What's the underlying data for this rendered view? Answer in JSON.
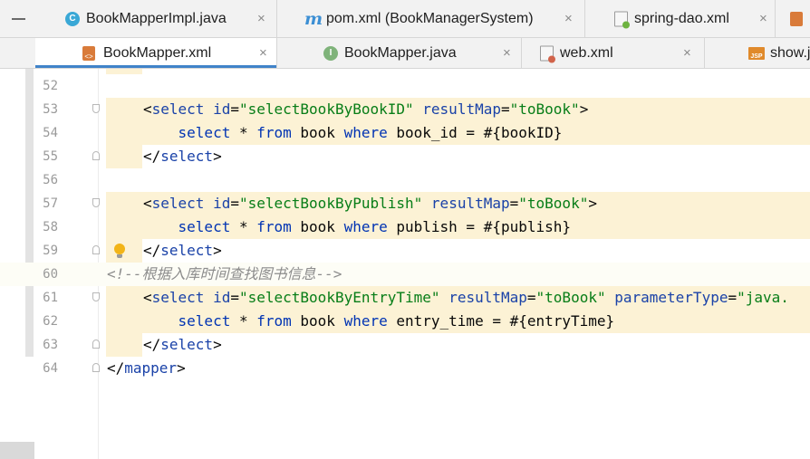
{
  "tabs_row1": [
    {
      "label": "BookMapperImpl.java",
      "icon": "class-icon",
      "close": "×"
    },
    {
      "label": "pom.xml (BookManagerSystem)",
      "icon": "maven-icon",
      "close": "×"
    },
    {
      "label": "spring-dao.xml",
      "icon": "spring-xml-icon",
      "close": "×"
    }
  ],
  "tabs_row2": [
    {
      "label": "BookMapper.xml",
      "icon": "mybatis-xml-icon",
      "close": "×",
      "active": true
    },
    {
      "label": "BookMapper.java",
      "icon": "interface-icon",
      "close": "×"
    },
    {
      "label": "web.xml",
      "icon": "web-xml-icon",
      "close": "×"
    },
    {
      "label": "show.j",
      "icon": "jsp-icon"
    }
  ],
  "icon_glyphs": {
    "class": "C",
    "interface": "I",
    "maven": "m",
    "xml": "<>",
    "jsp": "JSP"
  },
  "editor": {
    "lines": [
      {
        "num": "52",
        "parts": []
      },
      {
        "num": "53",
        "parts": [
          [
            "tag",
            "<"
          ],
          [
            "tname",
            "select"
          ],
          [
            "sp",
            " "
          ],
          [
            "attr",
            "id"
          ],
          [
            "tag",
            "="
          ],
          [
            "aval",
            "\"selectBookByBookID\""
          ],
          [
            "sp",
            " "
          ],
          [
            "attr",
            "resultMap"
          ],
          [
            "tag",
            "="
          ],
          [
            "aval",
            "\"toBook\""
          ],
          [
            "tag",
            ">"
          ]
        ]
      },
      {
        "num": "54",
        "parts": [
          [
            "sp",
            "    "
          ],
          [
            "kw",
            "select"
          ],
          [
            "sp",
            " * "
          ],
          [
            "kw",
            "from"
          ],
          [
            "sp",
            " book "
          ],
          [
            "kw",
            "where"
          ],
          [
            "sp",
            " book_id = #{bookID}"
          ]
        ]
      },
      {
        "num": "55",
        "parts": [
          [
            "tag",
            "</"
          ],
          [
            "tname",
            "select"
          ],
          [
            "tag",
            ">"
          ]
        ]
      },
      {
        "num": "56",
        "parts": []
      },
      {
        "num": "57",
        "parts": [
          [
            "tag",
            "<"
          ],
          [
            "tname",
            "select"
          ],
          [
            "sp",
            " "
          ],
          [
            "attr",
            "id"
          ],
          [
            "tag",
            "="
          ],
          [
            "aval",
            "\"selectBookByPublish\""
          ],
          [
            "sp",
            " "
          ],
          [
            "attr",
            "resultMap"
          ],
          [
            "tag",
            "="
          ],
          [
            "aval",
            "\"toBook\""
          ],
          [
            "tag",
            ">"
          ]
        ]
      },
      {
        "num": "58",
        "parts": [
          [
            "sp",
            "    "
          ],
          [
            "kw",
            "select"
          ],
          [
            "sp",
            " * "
          ],
          [
            "kw",
            "from"
          ],
          [
            "sp",
            " book "
          ],
          [
            "kw",
            "where"
          ],
          [
            "sp",
            " publish = #{publish}"
          ]
        ]
      },
      {
        "num": "59",
        "parts": [
          [
            "tag",
            "</"
          ],
          [
            "tname",
            "select"
          ],
          [
            "tag",
            ">"
          ]
        ]
      },
      {
        "num": "60",
        "parts": [
          [
            "comment",
            "<!--根据入库时间查找图书信息-->"
          ]
        ]
      },
      {
        "num": "61",
        "parts": [
          [
            "tag",
            "<"
          ],
          [
            "tname",
            "select"
          ],
          [
            "sp",
            " "
          ],
          [
            "attr",
            "id"
          ],
          [
            "tag",
            "="
          ],
          [
            "aval",
            "\"selectBookByEntryTime\""
          ],
          [
            "sp",
            " "
          ],
          [
            "attr",
            "resultMap"
          ],
          [
            "tag",
            "="
          ],
          [
            "aval",
            "\"toBook\""
          ],
          [
            "sp",
            " "
          ],
          [
            "attr",
            "parameterType"
          ],
          [
            "tag",
            "="
          ],
          [
            "aval",
            "\"java."
          ]
        ]
      },
      {
        "num": "62",
        "parts": [
          [
            "sp",
            "    "
          ],
          [
            "kw",
            "select"
          ],
          [
            "sp",
            " * "
          ],
          [
            "kw",
            "from"
          ],
          [
            "sp",
            " book "
          ],
          [
            "kw",
            "where"
          ],
          [
            "sp",
            " entry_time = #{entryTime}"
          ]
        ]
      },
      {
        "num": "63",
        "parts": [
          [
            "tag",
            "</"
          ],
          [
            "tname",
            "select"
          ],
          [
            "tag",
            ">"
          ]
        ]
      },
      {
        "num": "64",
        "parts": [
          [
            "tag",
            "</"
          ],
          [
            "tname",
            "mapper"
          ],
          [
            "tag",
            ">"
          ]
        ]
      }
    ]
  },
  "colors": {
    "accent": "#4083c9",
    "highlight": "#fcf2d5",
    "keyword": "#0033b3",
    "string": "#077d17",
    "comment": "#8c8c8c"
  }
}
